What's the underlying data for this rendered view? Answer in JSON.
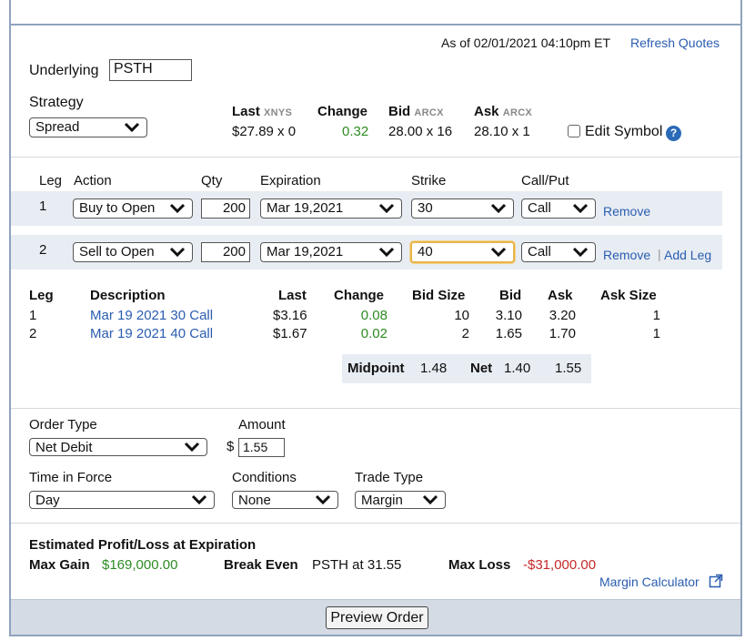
{
  "header": {
    "as_of": "As of 02/01/2021 04:10pm ET",
    "refresh": "Refresh Quotes"
  },
  "underlying": {
    "label": "Underlying",
    "value": "PSTH"
  },
  "strategy": {
    "label": "Strategy",
    "value": "Spread"
  },
  "quote": {
    "last_label": "Last",
    "last_exch": "XNYS",
    "last_value": "$27.89 x 0",
    "change_label": "Change",
    "change_value": "0.32",
    "bid_label": "Bid",
    "bid_exch": "ARCX",
    "bid_value": "28.00 x 16",
    "ask_label": "Ask",
    "ask_exch": "ARCX",
    "ask_value": "28.10 x 1",
    "edit_symbol": "Edit Symbol",
    "help": "?"
  },
  "legs_header": {
    "leg": "Leg",
    "action": "Action",
    "qty": "Qty",
    "expiration": "Expiration",
    "strike": "Strike",
    "callput": "Call/Put"
  },
  "legs": [
    {
      "num": "1",
      "action": "Buy to Open",
      "qty": "200",
      "expiration": "Mar 19,2021",
      "strike": "30",
      "callput": "Call",
      "remove": "Remove"
    },
    {
      "num": "2",
      "action": "Sell to Open",
      "qty": "200",
      "expiration": "Mar 19,2021",
      "strike": "40",
      "callput": "Call",
      "remove": "Remove",
      "add": "Add Leg"
    }
  ],
  "table": {
    "headers": {
      "leg": "Leg",
      "description": "Description",
      "last": "Last",
      "change": "Change",
      "bidsize": "Bid Size",
      "bid": "Bid",
      "ask": "Ask",
      "asksize": "Ask Size"
    },
    "rows": [
      {
        "leg": "1",
        "description": "Mar 19 2021 30 Call",
        "last": "$3.16",
        "change": "0.08",
        "bidsize": "10",
        "bid": "3.10",
        "ask": "3.20",
        "asksize": "1"
      },
      {
        "leg": "2",
        "description": "Mar 19 2021 40 Call",
        "last": "$1.67",
        "change": "0.02",
        "bidsize": "2",
        "bid": "1.65",
        "ask": "1.70",
        "asksize": "1"
      }
    ],
    "midpoint_label": "Midpoint",
    "midpoint_value": "1.48",
    "net_label": "Net",
    "net_bid": "1.40",
    "net_ask": "1.55"
  },
  "order": {
    "order_type_label": "Order Type",
    "order_type": "Net Debit",
    "amount_label": "Amount",
    "currency": "$",
    "amount": "1.55",
    "tif_label": "Time in Force",
    "tif": "Day",
    "conditions_label": "Conditions",
    "conditions": "None",
    "trade_type_label": "Trade Type",
    "trade_type": "Margin"
  },
  "pl": {
    "title": "Estimated Profit/Loss at Expiration",
    "max_gain_label": "Max Gain",
    "max_gain": "$169,000.00",
    "break_even_label": "Break Even",
    "break_even": "PSTH at 31.55",
    "max_loss_label": "Max Loss",
    "max_loss": "-$31,000.00",
    "margin_calc": "Margin Calculator"
  },
  "preview_button": "Preview Order",
  "colors": {
    "link": "#2a5db0",
    "positive": "#2e8b22",
    "negative": "#c62828",
    "panel": "#e8edf3",
    "border": "#8fa3bd"
  }
}
